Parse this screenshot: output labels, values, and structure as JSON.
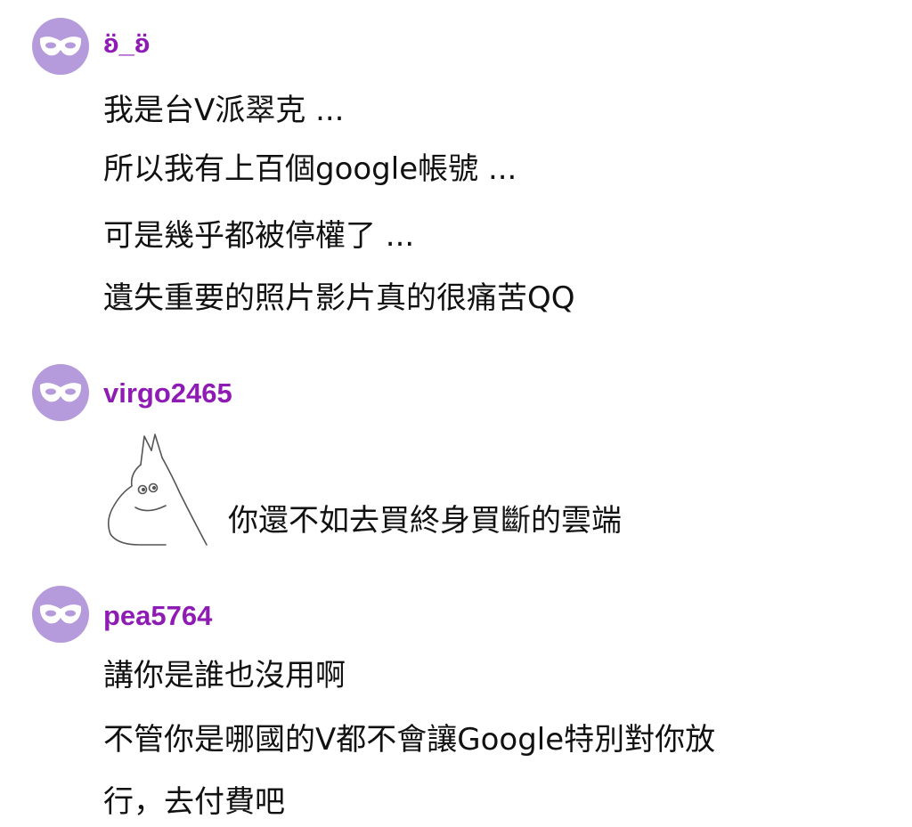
{
  "comments": [
    {
      "username": "ʚ̈_ʚ̈",
      "lines": [
        "我是台V派翠克 ...",
        "所以我有上百個google帳號 ...",
        "可是幾乎都被停權了 ...",
        "遺失重要的照片影片真的很痛苦QQ"
      ]
    },
    {
      "username": "virgo2465",
      "sticker": "moomin-sticker",
      "lines": [
        "你還不如去買終身買斷的雲端"
      ]
    },
    {
      "username": "pea5764",
      "lines": [
        "講你是誰也沒用啊",
        "不管你是哪國的V都不會讓Google特別對你放",
        "行，去付費吧"
      ]
    }
  ],
  "icons": {
    "avatar": "anonymous-mask-icon"
  },
  "colors": {
    "username": "#8e1cb4",
    "avatar_bg": "#b59bdb",
    "text": "#111111"
  }
}
